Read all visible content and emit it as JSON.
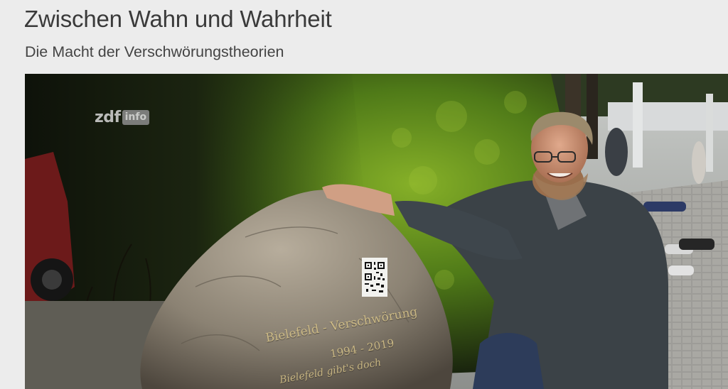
{
  "article": {
    "title": "Zwischen Wahn und Wahrheit",
    "subtitle": "Die Macht der Verschwörungstheorien"
  },
  "video": {
    "logo": {
      "brand": "zdf",
      "channel": "info"
    },
    "stone_inscription": {
      "line1": "Bielefeld - Verschwörung",
      "line2": "1994 - 2019",
      "line3": "Bielefeld gibt's doch"
    },
    "colors": {
      "hedge": "#5f8a1e",
      "stone": "#8f8677",
      "jacket": "#3b4247",
      "paving": "#9a9a98"
    }
  }
}
